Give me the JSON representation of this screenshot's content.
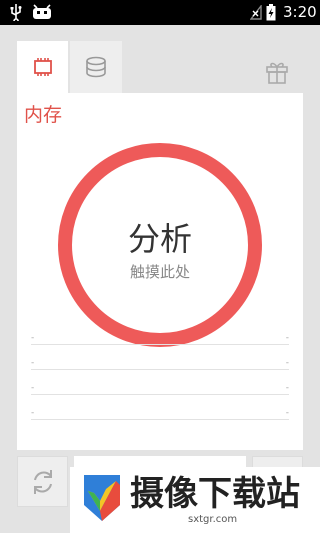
{
  "status_bar": {
    "time": "3:20",
    "icons": [
      "usb-icon",
      "android-bot-icon",
      "no-signal-icon",
      "battery-charging-icon"
    ]
  },
  "tabs": [
    {
      "icon": "memory-chip-icon",
      "active": true
    },
    {
      "icon": "storage-database-icon",
      "active": false
    }
  ],
  "header": {
    "gift_icon": "gift-icon"
  },
  "memory_panel": {
    "title": "内存",
    "analyze_label": "分析",
    "analyze_hint": "触摸此处",
    "ring_color": "#ee5a59",
    "accent_color": "#e0524a",
    "rows": [
      {
        "left": "-",
        "right": "-"
      },
      {
        "left": "-",
        "right": "-"
      },
      {
        "left": "-",
        "right": "-"
      },
      {
        "left": "-",
        "right": "-"
      }
    ]
  },
  "bottom_bar": {
    "refresh_icon": "refresh-icon"
  },
  "watermark": {
    "text": "摄像下载站",
    "url": "sxtgr.com"
  }
}
